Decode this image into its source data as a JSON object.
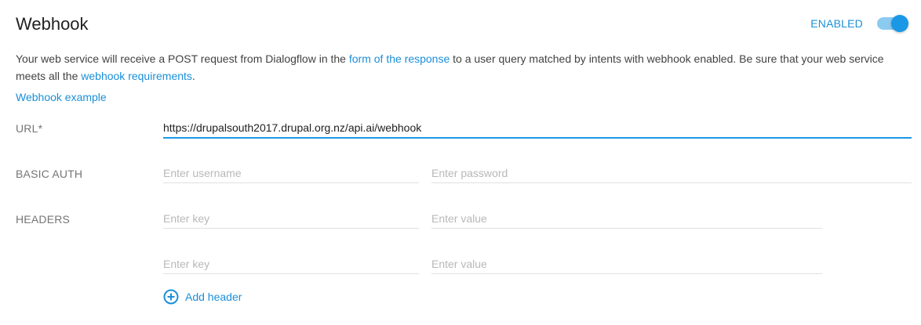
{
  "section": {
    "title": "Webhook",
    "toggle_label": "ENABLED",
    "enabled": true
  },
  "description": {
    "part1": "Your web service will receive a POST request from Dialogflow in the ",
    "link1": "form of the response",
    "part2": " to a user query matched by intents with webhook enabled. Be sure that your web service meets all the ",
    "link2": "webhook requirements",
    "part3": "."
  },
  "example_link": "Webhook example",
  "url": {
    "label": "URL*",
    "value": "https://drupalsouth2017.drupal.org.nz/api.ai/webhook"
  },
  "basic_auth": {
    "label": "BASIC AUTH",
    "username_placeholder": "Enter username",
    "password_placeholder": "Enter password"
  },
  "headers": {
    "label": "HEADERS",
    "rows": [
      {
        "key_placeholder": "Enter key",
        "value_placeholder": "Enter value"
      },
      {
        "key_placeholder": "Enter key",
        "value_placeholder": "Enter value"
      }
    ],
    "add_label": "Add header"
  },
  "colors": {
    "accent": "#1a98e6",
    "link": "#1a8fd8",
    "label": "#757575",
    "placeholder": "#b8b8b8"
  },
  "icons": {
    "toggle": "toggle-switch-icon",
    "add": "plus-circle-icon"
  }
}
